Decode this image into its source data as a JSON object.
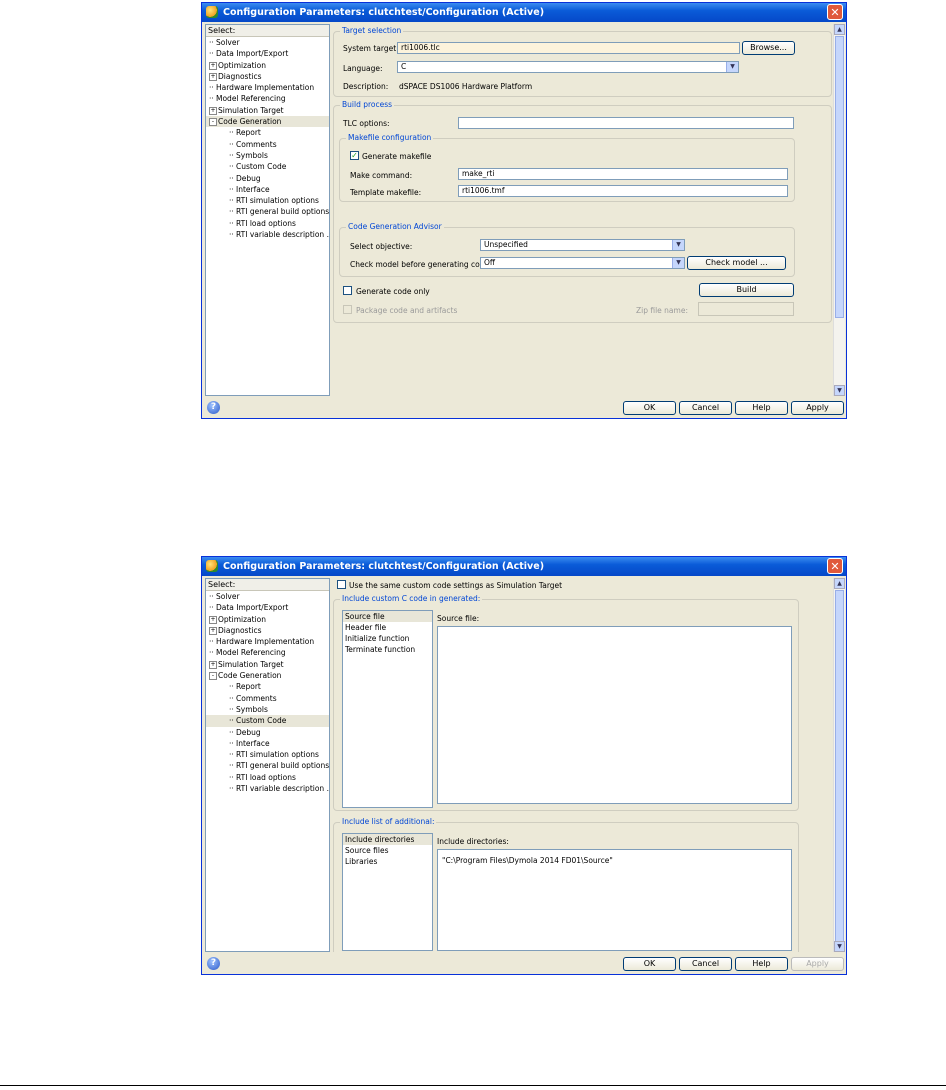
{
  "common": {
    "title": "Configuration Parameters: clutchtest/Configuration (Active)",
    "close_glyph": "✕",
    "tree_header": "Select:",
    "tree_items": [
      {
        "label": "Solver",
        "prefix": "",
        "indent": 0
      },
      {
        "label": "Data Import/Export",
        "prefix": "",
        "indent": 0
      },
      {
        "label": "Optimization",
        "prefix": "+",
        "indent": 0
      },
      {
        "label": "Diagnostics",
        "prefix": "+",
        "indent": 0
      },
      {
        "label": "Hardware Implementation",
        "prefix": "",
        "indent": 0
      },
      {
        "label": "Model Referencing",
        "prefix": "",
        "indent": 0
      },
      {
        "label": "Simulation Target",
        "prefix": "+",
        "indent": 0
      },
      {
        "label": "Code Generation",
        "prefix": "-",
        "indent": 0
      },
      {
        "label": "Report",
        "prefix": "",
        "indent": 1
      },
      {
        "label": "Comments",
        "prefix": "",
        "indent": 1
      },
      {
        "label": "Symbols",
        "prefix": "",
        "indent": 1
      },
      {
        "label": "Custom Code",
        "prefix": "",
        "indent": 1
      },
      {
        "label": "Debug",
        "prefix": "",
        "indent": 1
      },
      {
        "label": "Interface",
        "prefix": "",
        "indent": 1
      },
      {
        "label": "RTI simulation options",
        "prefix": "",
        "indent": 1
      },
      {
        "label": "RTI general build options",
        "prefix": "",
        "indent": 1
      },
      {
        "label": "RTI load options",
        "prefix": "",
        "indent": 1
      },
      {
        "label": "RTI variable description ...",
        "prefix": "",
        "indent": 1
      }
    ],
    "buttons": {
      "ok": "OK",
      "cancel": "Cancel",
      "help": "Help",
      "apply": "Apply"
    },
    "help_glyph": "?",
    "up_arrow": "▲",
    "down_arrow": "▼",
    "dropdown_glyph": "▼",
    "check_glyph": "✓"
  },
  "window1": {
    "selected_tree_index": 7,
    "target_selection": {
      "legend": "Target selection",
      "system_target_label": "System target file:",
      "system_target_value": "rti1006.tlc",
      "browse_label": "Browse...",
      "language_label": "Language:",
      "language_value": "C",
      "description_label": "Description:",
      "description_value": "dSPACE DS1006 Hardware Platform"
    },
    "build_process": {
      "legend": "Build process",
      "tlc_label": "TLC options:",
      "tlc_value": "",
      "makefile_legend": "Makefile configuration",
      "generate_makefile_label": "Generate makefile",
      "generate_makefile_checked": true,
      "make_command_label": "Make command:",
      "make_command_value": "make_rti",
      "template_label": "Template makefile:",
      "template_value": "rti1006.tmf"
    },
    "advisor": {
      "legend": "Code Generation Advisor",
      "objective_label": "Select objective:",
      "objective_value": "Unspecified",
      "check_label": "Check model before generating code:",
      "check_value": "Off",
      "check_model_button": "Check model ..."
    },
    "generate_code_only_label": "Generate code only",
    "generate_code_only_checked": false,
    "build_button": "Build",
    "package_label": "Package code and artifacts",
    "zip_label": "Zip file name:"
  },
  "window2": {
    "selected_tree_index": 11,
    "use_same_label": "Use the same custom code settings as Simulation Target",
    "include_custom": {
      "legend": "Include custom C code in generated:",
      "items": [
        "Source file",
        "Header file",
        "Initialize function",
        "Terminate function"
      ],
      "selected": 0,
      "right_label": "Source file:"
    },
    "include_list": {
      "legend": "Include list of additional:",
      "items": [
        "Include directories",
        "Source files",
        "Libraries"
      ],
      "selected": 0,
      "right_label": "Include directories:",
      "value": "\"C:\\Program Files\\Dymola 2014 FD01\\Source\""
    }
  }
}
